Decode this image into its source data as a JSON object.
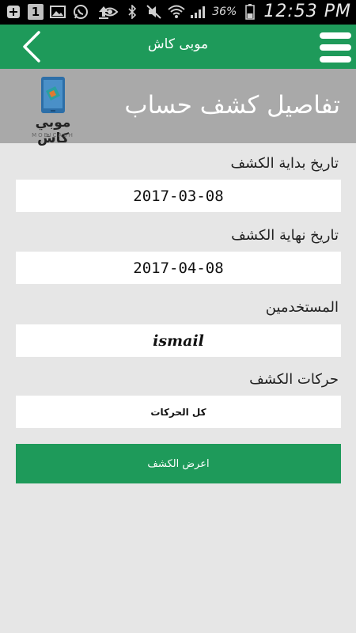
{
  "status_bar": {
    "notification_count": "1",
    "battery": "36%",
    "time": "12:53 PM"
  },
  "header": {
    "title": "موبى كاش"
  },
  "banner": {
    "title": "تفاصيل كشف حساب",
    "logo_text": "موبي كاش",
    "logo_subtext": "MOBICASH"
  },
  "form": {
    "start_date": {
      "label": "تاريخ بداية الكشف",
      "value": "2017-03-08"
    },
    "end_date": {
      "label": "تاريخ نهاية الكشف",
      "value": "2017-04-08"
    },
    "users": {
      "label": "المستخدمين",
      "value": "ismail"
    },
    "transactions": {
      "label": "حركات الكشف",
      "value": "كل الحركات"
    },
    "submit_label": "اعرض الكشف"
  },
  "colors": {
    "accent": "#1e9a5a",
    "banner": "#a9a9a9",
    "background": "#e6e6e6"
  }
}
